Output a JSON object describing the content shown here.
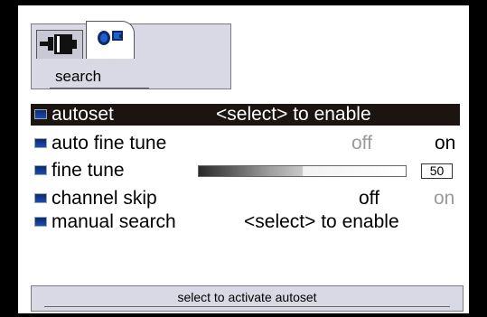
{
  "header": {
    "tabs": [
      {
        "icon": "antenna-plug-icon"
      },
      {
        "icon": "camera-tv-icon"
      }
    ],
    "title": "search"
  },
  "menu": {
    "items": [
      {
        "label": "autoset",
        "value": "<select> to enable"
      },
      {
        "label": "auto fine tune",
        "off": "off",
        "on": "on",
        "selected_state": "on"
      },
      {
        "label": "fine tune",
        "slider_value": "50",
        "slider_level_fraction": 0.5
      },
      {
        "label": "channel skip",
        "off": "off",
        "on": "on",
        "selected_state": "off"
      },
      {
        "label": "manual search",
        "value": "<select> to enable"
      }
    ]
  },
  "status": {
    "text": "select to activate autoset"
  },
  "colors": {
    "selected_row_bg": "#1c1410",
    "panel_bg": "#ffffff",
    "header_bg": "#d9d9e6",
    "bullet": "#1c4bb0"
  }
}
